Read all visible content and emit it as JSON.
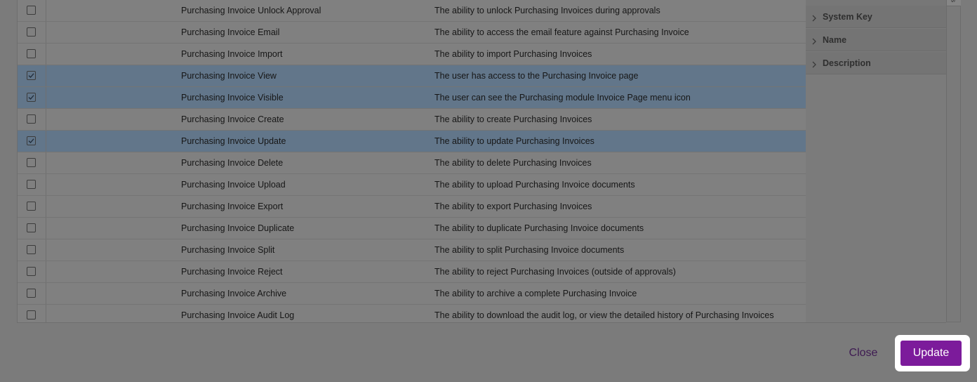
{
  "grid": {
    "rows": [
      {
        "checked": false,
        "name": "Purchasing Invoice Unlock Approval",
        "description": "The ability to unlock Purchasing Invoices during approvals"
      },
      {
        "checked": false,
        "name": "Purchasing Invoice Email",
        "description": "The ability to access the email feature against Purchasing Invoice"
      },
      {
        "checked": false,
        "name": "Purchasing Invoice Import",
        "description": "The ability to import Purchasing Invoices"
      },
      {
        "checked": true,
        "name": "Purchasing Invoice View",
        "description": "The user has access to the Purchasing Invoice page"
      },
      {
        "checked": true,
        "name": "Purchasing Invoice Visible",
        "description": "The user can see the Purchasing module Invoice Page menu icon"
      },
      {
        "checked": false,
        "name": "Purchasing Invoice Create",
        "description": "The ability to create Purchasing Invoices"
      },
      {
        "checked": true,
        "name": "Purchasing Invoice Update",
        "description": "The ability to update Purchasing Invoices"
      },
      {
        "checked": false,
        "name": "Purchasing Invoice Delete",
        "description": "The ability to delete Purchasing Invoices"
      },
      {
        "checked": false,
        "name": "Purchasing Invoice Upload",
        "description": "The ability to upload Purchasing Invoice documents"
      },
      {
        "checked": false,
        "name": "Purchasing Invoice Export",
        "description": "The ability to export Purchasing Invoices"
      },
      {
        "checked": false,
        "name": "Purchasing Invoice Duplicate",
        "description": "The ability to duplicate Purchasing Invoice documents"
      },
      {
        "checked": false,
        "name": "Purchasing Invoice Split",
        "description": "The ability to split Purchasing Invoice documents"
      },
      {
        "checked": false,
        "name": "Purchasing Invoice Reject",
        "description": "The ability to reject Purchasing Invoices (outside of approvals)"
      },
      {
        "checked": false,
        "name": "Purchasing Invoice Archive",
        "description": "The ability to archive a complete Purchasing Invoice"
      },
      {
        "checked": false,
        "name": "Purchasing Invoice Audit Log",
        "description": "The ability to download the audit log, or view the detailed history of Purchasing Invoices"
      }
    ]
  },
  "columns_panel": {
    "items": [
      {
        "label": "System Key",
        "icon": "chevron-right-icon"
      },
      {
        "label": "Name",
        "icon": "chevron-right-icon"
      },
      {
        "label": "Description",
        "icon": "chevron-right-icon"
      }
    ],
    "rail_tab_label": "s"
  },
  "footer": {
    "close_label": "Close",
    "update_label": "Update"
  },
  "colors": {
    "overlay_background": "#7b7b7b",
    "selected_row": "#62768a",
    "update_button": "#7c1b9b",
    "close_text": "#3e1a52",
    "highlight_ring": "#ffffff"
  }
}
